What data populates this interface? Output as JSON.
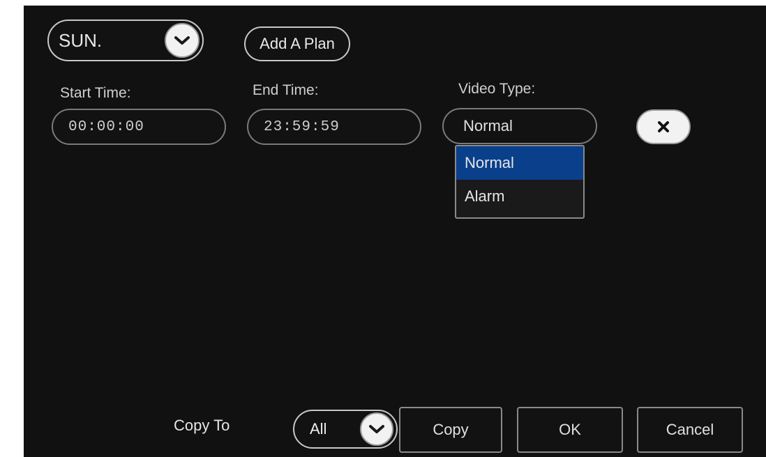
{
  "schedule": {
    "day_select": {
      "value": "SUN."
    },
    "add_plan_label": "Add A Plan"
  },
  "plan": {
    "start_time_label": "Start Time:",
    "start_time_value": "00:00:00",
    "end_time_label": "End Time:",
    "end_time_value": "23:59:59",
    "video_type_label": "Video Type:",
    "video_type_value": "Normal",
    "video_type_options": [
      "Normal",
      "Alarm"
    ],
    "video_type_selected_option": "Normal"
  },
  "footer": {
    "copy_to_label": "Copy To",
    "copy_target": "All",
    "copy_label": "Copy",
    "ok_label": "OK",
    "cancel_label": "Cancel"
  },
  "colors": {
    "background": "#111111",
    "selection": "#0a3f8c",
    "text": "#d8d8d8"
  },
  "icons": {
    "day_dropdown": "chevron-down-icon",
    "delete_plan": "close-icon",
    "copy_dropdown": "chevron-down-icon"
  }
}
